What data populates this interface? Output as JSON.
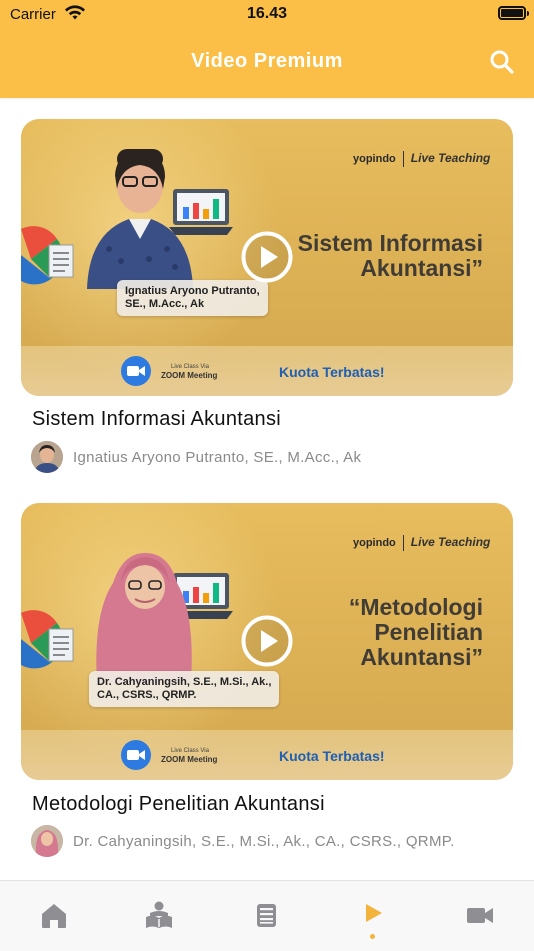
{
  "status_bar": {
    "carrier": "Carrier",
    "time": "16.43"
  },
  "header": {
    "title": "Video Premium",
    "search_icon": "search-icon"
  },
  "colors": {
    "accent": "#fbbf47",
    "active_tab": "#f2b43c",
    "inactive_tab": "#8e8e93",
    "kuota_text": "#1e5fb3"
  },
  "videos": [
    {
      "title": "Sistem Informasi Akuntansi",
      "author": "Ignatius Aryono Putranto, SE., M.Acc., Ak",
      "thumbnail": {
        "brand": "yopindo",
        "brand_tag": "Live Teaching",
        "headline": "Sistem Informasi\nAkuntansi”",
        "presenter": "Ignatius Aryono Putranto,\nSE., M.Acc., Ak",
        "zoom_sub": "Live Class Via",
        "zoom_label": "ZOOM Meeting",
        "quota": "Kuota Terbatas!"
      }
    },
    {
      "title": "Metodologi Penelitian Akuntansi",
      "author": "Dr. Cahyaningsih, S.E., M.Si., Ak., CA., CSRS., QRMP.",
      "thumbnail": {
        "brand": "yopindo",
        "brand_tag": "Live Teaching",
        "headline": "“Metodologi\nPenelitian\nAkuntansi”",
        "presenter": "Dr. Cahyaningsih, S.E., M.Si., Ak.,\nCA., CSRS., QRMP.",
        "zoom_sub": "Live Class Via",
        "zoom_label": "ZOOM Meeting",
        "quota": "Kuota Terbatas!"
      }
    }
  ],
  "tabs": [
    {
      "icon": "home-icon",
      "active": false
    },
    {
      "icon": "reading-person-icon",
      "active": false
    },
    {
      "icon": "book-icon",
      "active": false
    },
    {
      "icon": "play-icon",
      "active": true
    },
    {
      "icon": "video-camera-icon",
      "active": false
    }
  ]
}
